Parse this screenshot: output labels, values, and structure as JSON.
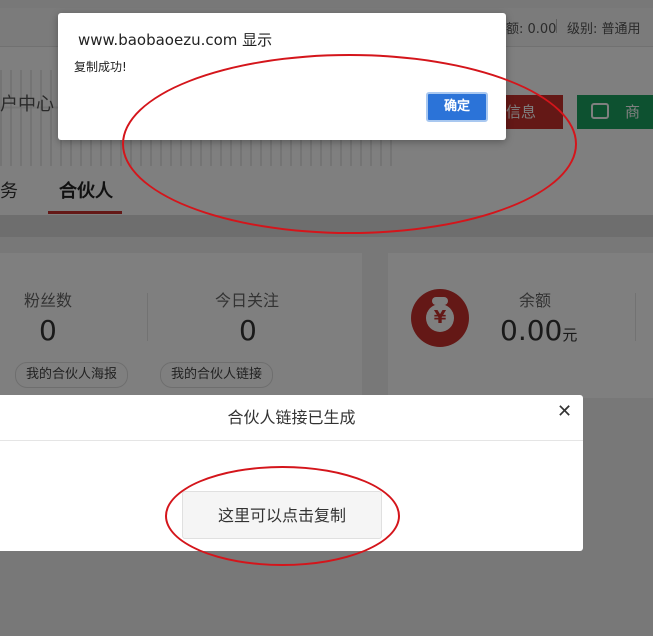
{
  "topbar": {
    "balance_text": "额: 0.00",
    "level_text": "级别: 普通用"
  },
  "header": {
    "center_title": "户中心",
    "info_button": "信息",
    "merchant_button": "商家"
  },
  "tabs": {
    "left_tab": "务",
    "partner_tab": "合伙人"
  },
  "stats": {
    "fans_label": "粉丝数",
    "fans_value": "0",
    "today_follow_label": "今日关注",
    "today_follow_value": "0",
    "balance_label": "余额",
    "balance_value": "0.00",
    "balance_unit": "元",
    "poster_button": "我的合伙人海报",
    "link_button": "我的合伙人链接",
    "money_glyph": "¥"
  },
  "link_dialog": {
    "title": "合伙人链接已生成",
    "close_glyph": "✕",
    "copy_button": "这里可以点击复制"
  },
  "alert": {
    "host": "www.baobaoezu.com 显示",
    "message": "复制成功!",
    "ok_button": "确定"
  },
  "colors": {
    "accent_red": "#c9302c",
    "merchant_green": "#1aa260",
    "alert_blue": "#2b73d8",
    "annotation_red": "#d4151b"
  }
}
